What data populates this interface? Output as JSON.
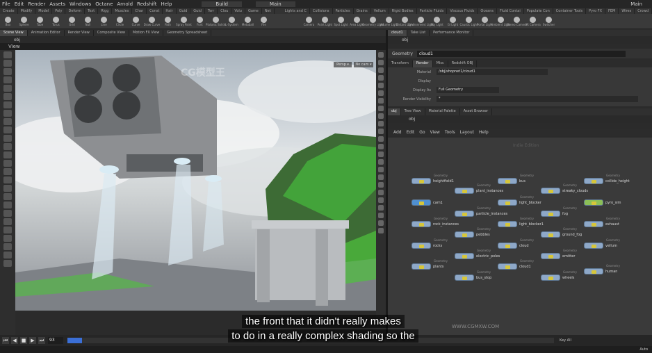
{
  "menubar": [
    "File",
    "Edit",
    "Render",
    "Assets",
    "Windows",
    "Octane",
    "Arnold",
    "Redshift",
    "Help"
  ],
  "desktop": "Build",
  "desktop_right": "Main",
  "desktop_far_right": "Main",
  "shelf_tabs_left": [
    "Create",
    "Modify",
    "Model",
    "Poly",
    "Deform",
    "Text",
    "Rigg",
    "Muscles",
    "Char",
    "Const",
    "Hair",
    "Guid",
    "Guid",
    "Terr",
    "Clou",
    "Volu",
    "Game",
    "Net"
  ],
  "shelf_tabs_right": [
    "Lights and C",
    "Collisions",
    "Particles",
    "Grains",
    "Vellum",
    "Rigid Bodies",
    "Particle Fluids",
    "Viscous Fluids",
    "Oceans",
    "Fluid Contai",
    "Populate Con",
    "Container Tools",
    "Pyro FX",
    "FEM",
    "Wires",
    "Crowd"
  ],
  "shelf_tools_left": [
    "Box",
    "Sphere",
    "Tube",
    "Torus",
    "Grid",
    "Null",
    "Line",
    "Circle",
    "Curve",
    "Draw Curve",
    "Path",
    "Spray Paint",
    "Font",
    "Platonic Solids",
    "L-System",
    "Metaball",
    "File"
  ],
  "shelf_tools_right": [
    "Camera",
    "Point Light",
    "Spot Light",
    "Area Light",
    "Geometry Light",
    "Volume Light",
    "Distant Light",
    "Environment Light",
    "Sky Light",
    "GI Light",
    "Caustic Light",
    "Portal Light",
    "Ambient Light",
    "Stereo Camera",
    "VR Camera",
    "Switcher"
  ],
  "left_pane_tabs": [
    "Scene View",
    "Animation Editor",
    "Render View",
    "Composite View",
    "Motion FX View",
    "Geometry Spreadsheet"
  ],
  "left_path": "obj",
  "view_title": "View",
  "viewport_buttons": {
    "persp": "Persp ▾",
    "cam": "No cam ▾"
  },
  "right_top_tabs": [
    "cloud1",
    "Take List",
    "Performance Monitor"
  ],
  "right_top_path": "obj",
  "geometry": {
    "type": "Geometry",
    "name": "cloud1"
  },
  "param_tabs": [
    "Transform",
    "Render",
    "Misc",
    "Redshift OBJ"
  ],
  "params": [
    {
      "label": "Material",
      "value": "/obj/shopnet1/cloud1"
    },
    {
      "label": "Display",
      "value": ""
    },
    {
      "label": "Display As",
      "value": "Full Geometry"
    },
    {
      "label": "Render Visibility",
      "value": "*"
    }
  ],
  "network_tabs": [
    "obj",
    "Tree View",
    "Material Palette",
    "Asset Browser"
  ],
  "network_path": "obj",
  "network_menu": [
    "Add",
    "Edit",
    "Go",
    "View",
    "Tools",
    "Layout",
    "Help"
  ],
  "network_watermark": "Indie Edition",
  "nodes": [
    {
      "label": "heightfield1",
      "type": "Geometry",
      "kind": "geo"
    },
    {
      "label": "cam1",
      "type": "",
      "kind": "cam"
    },
    {
      "label": "rock_instances",
      "type": "Geometry",
      "kind": "geo"
    },
    {
      "label": "rocks",
      "type": "Geometry",
      "kind": "geo"
    },
    {
      "label": "plants",
      "type": "Geometry",
      "kind": "geo"
    },
    {
      "label": "plant_instances",
      "type": "Geometry",
      "kind": "geo"
    },
    {
      "label": "particle_instances",
      "type": "Geometry",
      "kind": "geo"
    },
    {
      "label": "pebbles",
      "type": "Geometry",
      "kind": "geo"
    },
    {
      "label": "electric_poles",
      "type": "Geometry",
      "kind": "geo"
    },
    {
      "label": "bus_stop",
      "type": "Geometry",
      "kind": "geo"
    },
    {
      "label": "bus",
      "type": "Geometry",
      "kind": "geo"
    },
    {
      "label": "light_blocker",
      "type": "Geometry",
      "kind": "geo"
    },
    {
      "label": "light_blocker1",
      "type": "Geometry",
      "kind": "geo"
    },
    {
      "label": "cloud",
      "type": "Geometry",
      "kind": "geo"
    },
    {
      "label": "cloud1",
      "type": "Geometry",
      "kind": "geo"
    },
    {
      "label": "streaky_clouds",
      "type": "Geometry",
      "kind": "geo"
    },
    {
      "label": "fog",
      "type": "Geometry",
      "kind": "geo"
    },
    {
      "label": "ground_fog",
      "type": "Geometry",
      "kind": "geo"
    },
    {
      "label": "emitter",
      "type": "Geometry",
      "kind": "geo"
    },
    {
      "label": "wheels",
      "type": "Geometry",
      "kind": "geo"
    },
    {
      "label": "collide_height",
      "type": "Geometry",
      "kind": "geo"
    },
    {
      "label": "pyro_sim",
      "type": "",
      "kind": "green"
    },
    {
      "label": "exhaust",
      "type": "Geometry",
      "kind": "geo"
    },
    {
      "label": "vellum",
      "type": "Geometry",
      "kind": "geo"
    },
    {
      "label": "human",
      "type": "Geometry",
      "kind": "geo"
    }
  ],
  "timeline": {
    "frame": "93",
    "progress": 0.03
  },
  "subtitle": {
    "line1": "the front that it didn't really makes",
    "line2": "to do in a really complex shading so the"
  },
  "status_right": [
    "Key All",
    "Auto"
  ],
  "watermarks": [
    "CG模型王",
    "WWW.CGMXW.COM"
  ]
}
